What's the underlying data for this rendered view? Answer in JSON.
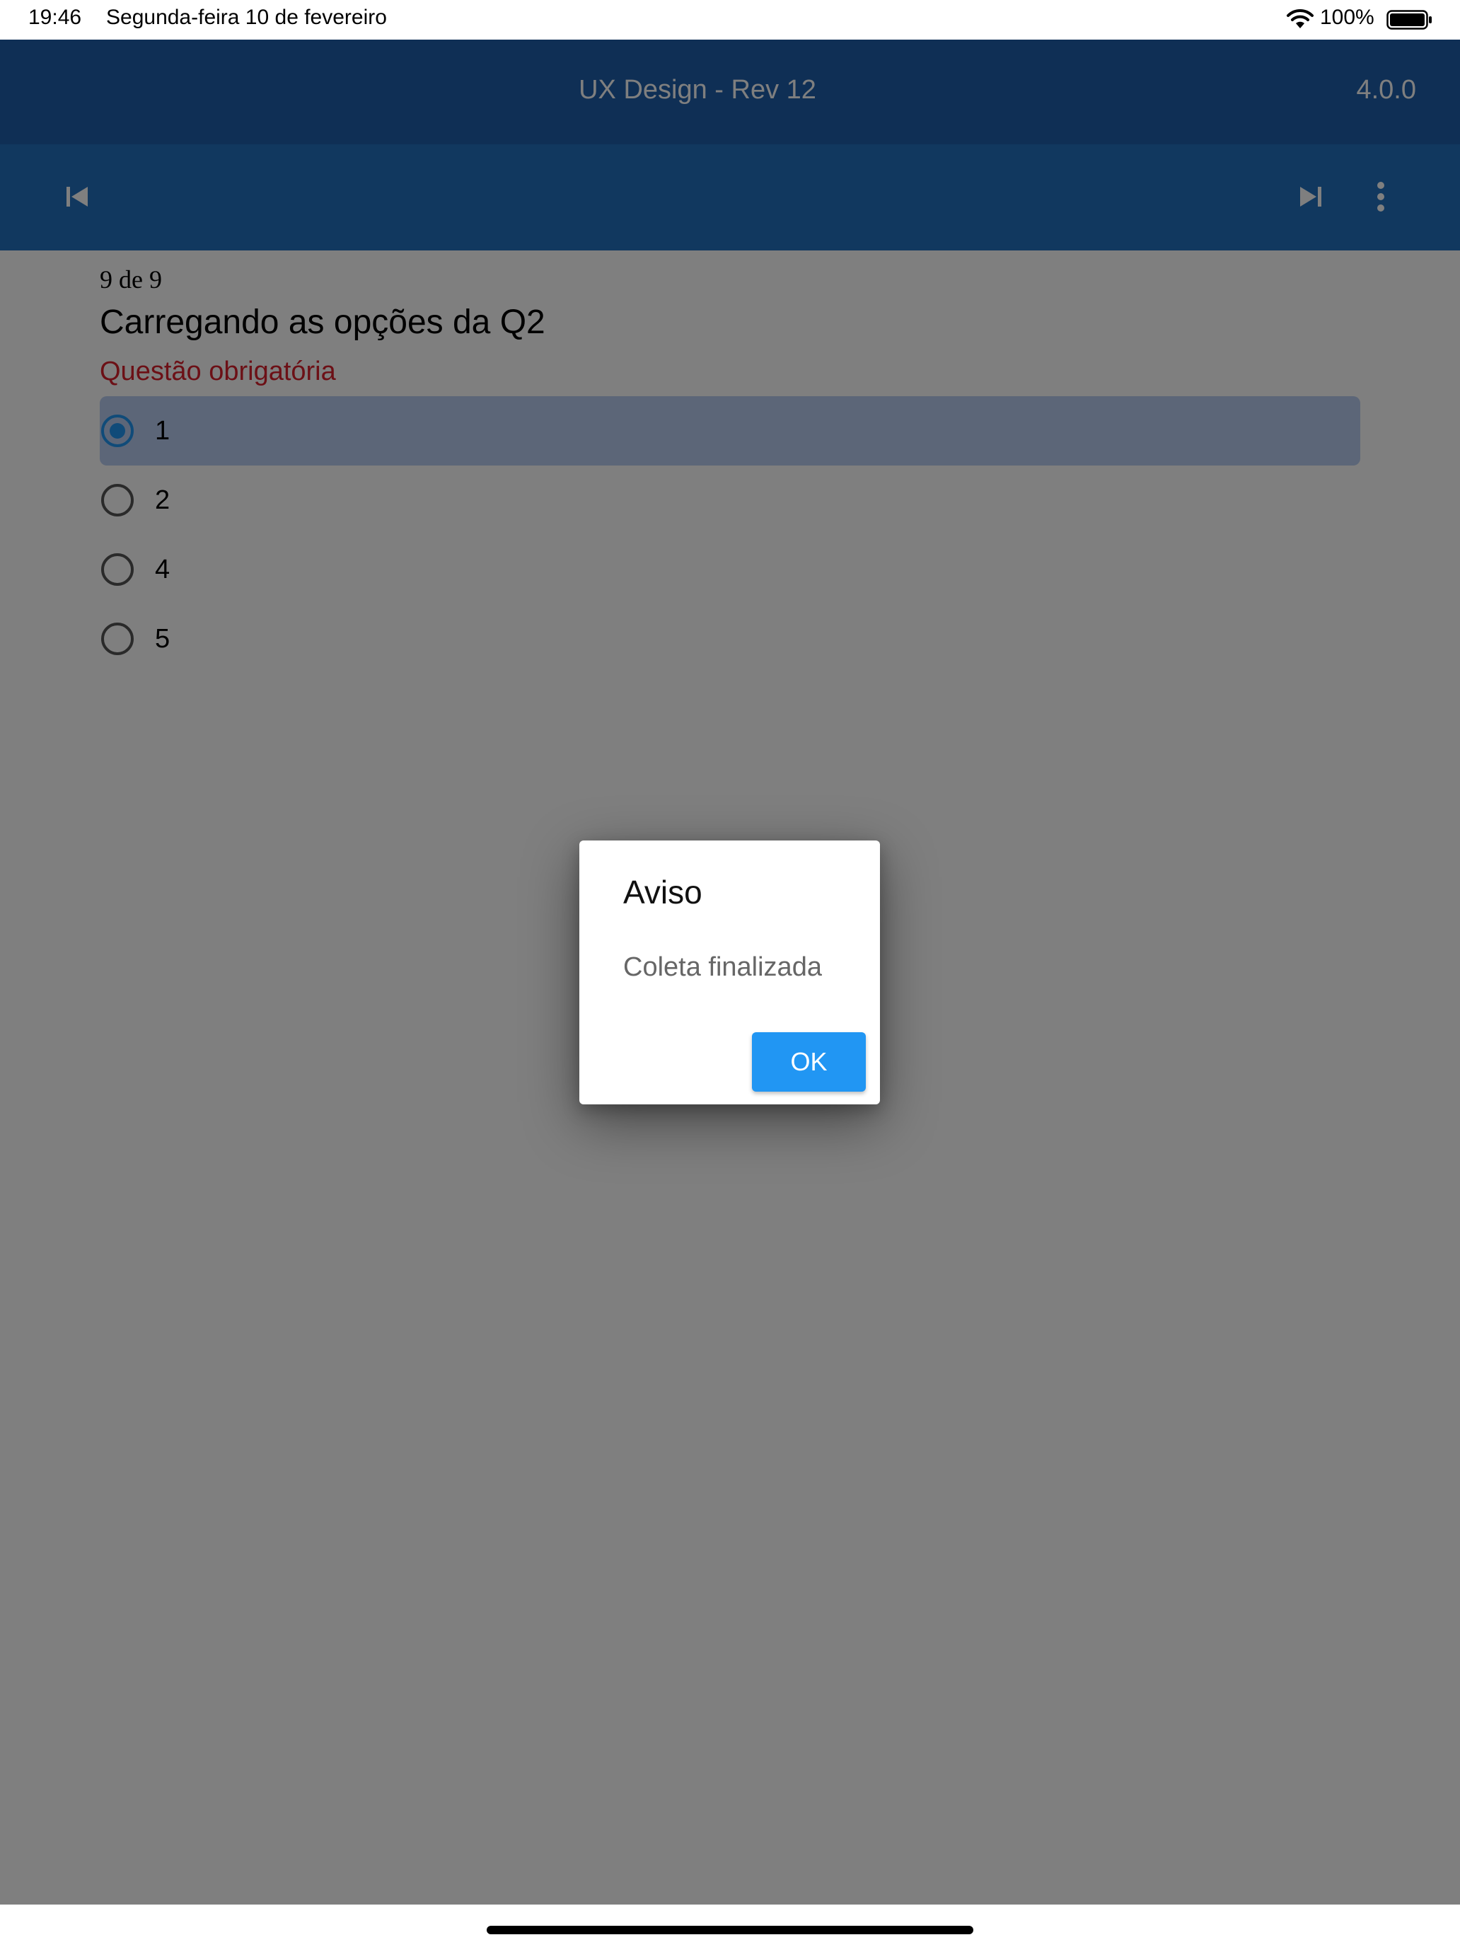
{
  "status_bar": {
    "time": "19:46",
    "date": "Segunda-feira 10 de fevereiro",
    "battery": "100%",
    "icons": [
      "wifi-icon",
      "battery-icon"
    ]
  },
  "app_bar": {
    "title": "UX Design - Rev 12",
    "version": "4.0.0",
    "icons": [
      "skip-previous-icon",
      "skip-next-icon",
      "more-vert-icon"
    ],
    "color_top": "#1e5faa",
    "color_bottom": "#2270bf"
  },
  "question": {
    "counter": "9 de 9",
    "title": "Carregando as opções da Q2",
    "required_text": "Questão obrigatória",
    "selected_option": "1",
    "options": [
      {
        "label": "1",
        "selected": true
      },
      {
        "label": "2",
        "selected": false
      },
      {
        "label": "4",
        "selected": false
      },
      {
        "label": "5",
        "selected": false
      }
    ]
  },
  "dialog": {
    "title": "Aviso",
    "message": "Coleta finalizada",
    "ok_label": "OK",
    "button_color": "#2196f3"
  },
  "colors": {
    "required": "#d9212c",
    "selected_row": "#b9cdf0",
    "radio_selected": "#2196f3",
    "radio_unselected": "#555555"
  }
}
